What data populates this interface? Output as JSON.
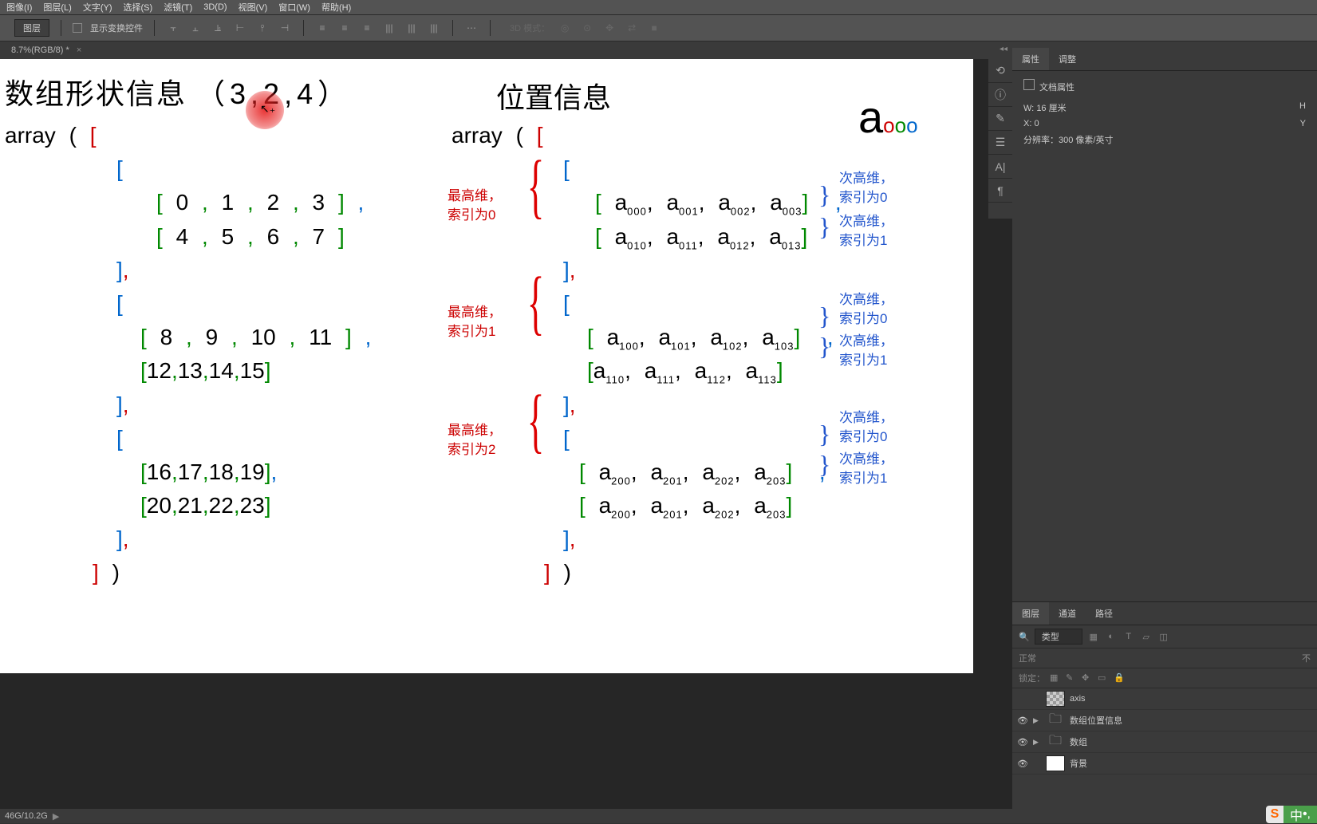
{
  "menu": {
    "items": [
      "图像(I)",
      "图层(L)",
      "文字(Y)",
      "选择(S)",
      "滤镜(T)",
      "3D(D)",
      "视图(V)",
      "窗口(W)",
      "帮助(H)"
    ]
  },
  "options": {
    "layer_dd": "图层",
    "show_transform": "显示变换控件",
    "mode3d": "3D 模式："
  },
  "tab": {
    "title": "8.7%(RGB/8) *"
  },
  "properties": {
    "tab1": "属性",
    "tab2": "调整",
    "doc_props": "文档属性",
    "w_label": "W:",
    "w_value": "16 厘米",
    "h_label": "H",
    "x_label": "X:",
    "x_value": "0",
    "y_label": "Y",
    "res_label": "分辨率：",
    "res_value": "300 像素/英寸"
  },
  "layers_panel": {
    "tab1": "图层",
    "tab2": "通道",
    "tab3": "路径",
    "filter_label": "类型",
    "blend": "正常",
    "opacity": "不",
    "lock_label": "锁定：",
    "items": [
      {
        "name": "axis",
        "type": "trans"
      },
      {
        "name": "数组位置信息",
        "type": "folder"
      },
      {
        "name": "数组",
        "type": "folder"
      },
      {
        "name": "背景",
        "type": "white"
      }
    ]
  },
  "status": {
    "text": "46G/10.2G"
  },
  "ime": {
    "s": "S",
    "c": "中"
  },
  "doc": {
    "title_left_1": "数组形状信息",
    "title_left_2": "（3,2,4）",
    "title_right": "位置信息",
    "array_word": "array",
    "left_data": [
      [
        [
          0,
          1,
          2,
          3
        ],
        [
          4,
          5,
          6,
          7
        ]
      ],
      [
        [
          8,
          9,
          10,
          11
        ],
        [
          12,
          13,
          14,
          15
        ]
      ],
      [
        [
          16,
          17,
          18,
          19
        ],
        [
          20,
          21,
          22,
          23
        ]
      ]
    ],
    "right_data": [
      [
        [
          "000",
          "001",
          "002",
          "003"
        ],
        [
          "010",
          "011",
          "012",
          "013"
        ]
      ],
      [
        [
          "100",
          "101",
          "102",
          "103"
        ],
        [
          "110",
          "111",
          "112",
          "113"
        ]
      ],
      [
        [
          "200",
          "201",
          "202",
          "203"
        ],
        [
          "200",
          "201",
          "202",
          "203"
        ]
      ]
    ],
    "annot_highest": [
      "最高维，",
      "索引为0",
      "最高维，",
      "索引为1",
      "最高维，",
      "索引为2"
    ],
    "annot_second": [
      "次高维，",
      "索引为0",
      "次高维，",
      "索引为1"
    ],
    "a_label": "a"
  }
}
